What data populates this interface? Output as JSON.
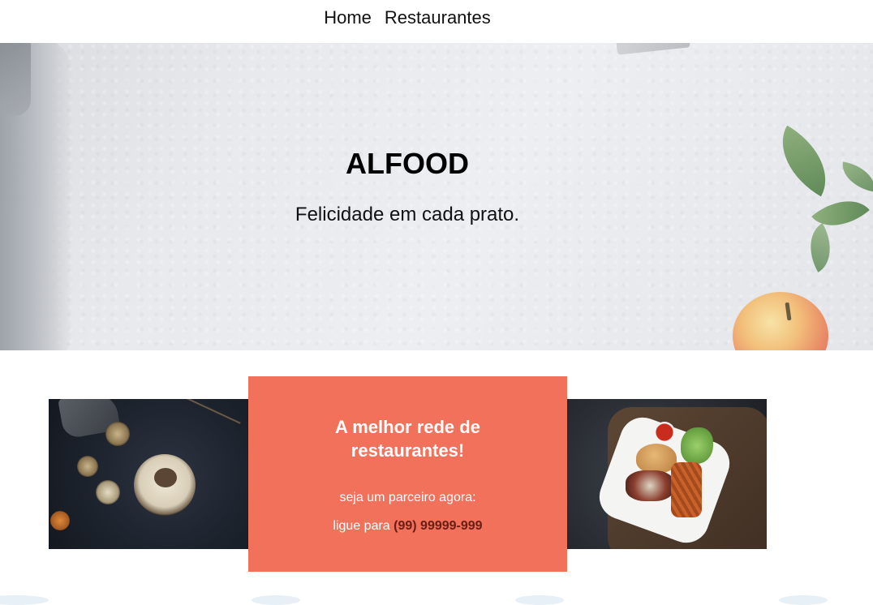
{
  "nav": {
    "items": [
      {
        "label": "Home"
      },
      {
        "label": "Restaurantes"
      }
    ]
  },
  "hero": {
    "title": "ALFOOD",
    "subtitle": "Felicidade em cada prato."
  },
  "promo": {
    "title": "A melhor rede de restaurantes!",
    "line1": "seja um parceiro agora:",
    "line2_prefix": "ligue para ",
    "phone": "(99) 99999-999",
    "card_color": "#f2715b",
    "phone_color": "#6a1d14"
  }
}
